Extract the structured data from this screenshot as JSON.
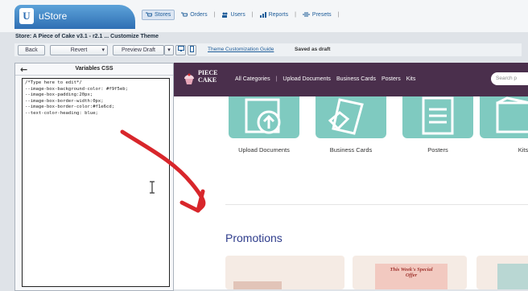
{
  "app": {
    "brand": "uStore"
  },
  "nav": {
    "items": [
      {
        "label": "Stores",
        "icon": "cart-icon"
      },
      {
        "label": "Orders",
        "icon": "cart-icon"
      },
      {
        "label": "Users",
        "icon": "users-icon"
      },
      {
        "label": "Reports",
        "icon": "chart-icon"
      },
      {
        "label": "Presets",
        "icon": "preset-icon"
      }
    ]
  },
  "breadcrumb": "Store: A Piece of Cake v3.1 - r2.1 ... Customize Theme",
  "toolbar": {
    "back": "Back",
    "revert": "Revert",
    "preview": "Preview Draft",
    "guide": "Theme Customization Guide",
    "status": "Saved as draft"
  },
  "panel": {
    "title": "Variables CSS",
    "code": "/*Type here to edit*/\n--image-box-background-color: #f9f5eb;\n--image-box-padding:20px;\n--image-box-border-width:0px;\n--image-box-border-color:#f1e6cd;\n--text-color-heading: blue;"
  },
  "site": {
    "logo_line1": "PIECE",
    "logo_line2": "CAKE",
    "links": [
      "All Categories",
      "Upload Documents",
      "Business Cards",
      "Posters",
      "Kits"
    ],
    "search_placeholder": "Search p",
    "categories": [
      "Upload Documents",
      "Business Cards",
      "Posters",
      "Kits"
    ],
    "promotions_title": "Promotions",
    "promo_line1": "This Week's Special",
    "promo_line2": "Offer"
  },
  "colors": {
    "accent": "#2f6fb4",
    "site_nav": "#4a2f4c",
    "tile": "#7fcac0",
    "arrow": "#d8262b",
    "promotions": "#2f3d8c"
  }
}
